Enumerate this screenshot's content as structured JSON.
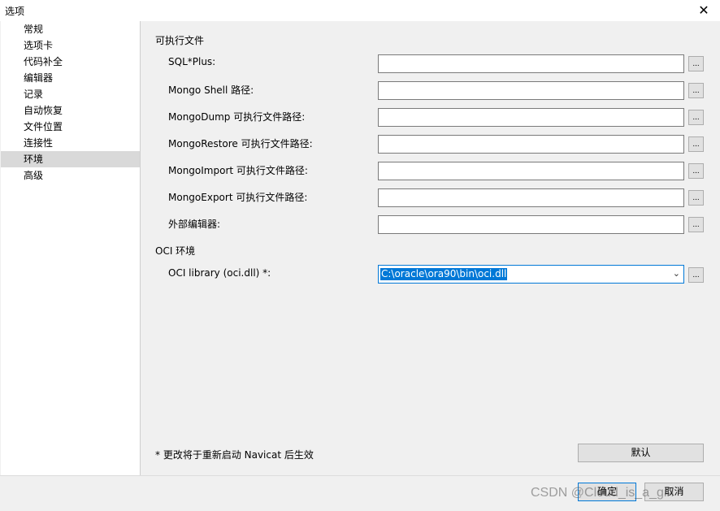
{
  "window": {
    "title": "选项",
    "close_glyph": "✕"
  },
  "sidebar": {
    "items": [
      {
        "label": "常规"
      },
      {
        "label": "选项卡"
      },
      {
        "label": "代码补全"
      },
      {
        "label": "编辑器"
      },
      {
        "label": "记录"
      },
      {
        "label": "自动恢复"
      },
      {
        "label": "文件位置"
      },
      {
        "label": "连接性"
      },
      {
        "label": "环境",
        "selected": true
      },
      {
        "label": "高级"
      }
    ]
  },
  "executables": {
    "section_title": "可执行文件",
    "rows": [
      {
        "label": "SQL*Plus:",
        "value": ""
      },
      {
        "label": "Mongo Shell 路径:",
        "value": ""
      },
      {
        "label": "MongoDump 可执行文件路径:",
        "value": ""
      },
      {
        "label": "MongoRestore 可执行文件路径:",
        "value": ""
      },
      {
        "label": "MongoImport 可执行文件路径:",
        "value": ""
      },
      {
        "label": "MongoExport 可执行文件路径:",
        "value": ""
      },
      {
        "label": "外部编辑器:",
        "value": ""
      }
    ],
    "browse_label": "..."
  },
  "oci": {
    "section_title": "OCI 环境",
    "library_label": "OCI library (oci.dll) *:",
    "library_value": "C:\\oracle\\ora90\\bin\\oci.dll",
    "browse_label": "..."
  },
  "footer": {
    "note": "* 更改将于重新启动 Navicat 后生效",
    "default_button": "默认",
    "ok_button": "确定",
    "cancel_button": "取消",
    "watermark": "CSDN @Cloud_is_a_girl"
  },
  "colors": {
    "accent": "#0078d7",
    "selected_bg": "#d9d9d9"
  }
}
